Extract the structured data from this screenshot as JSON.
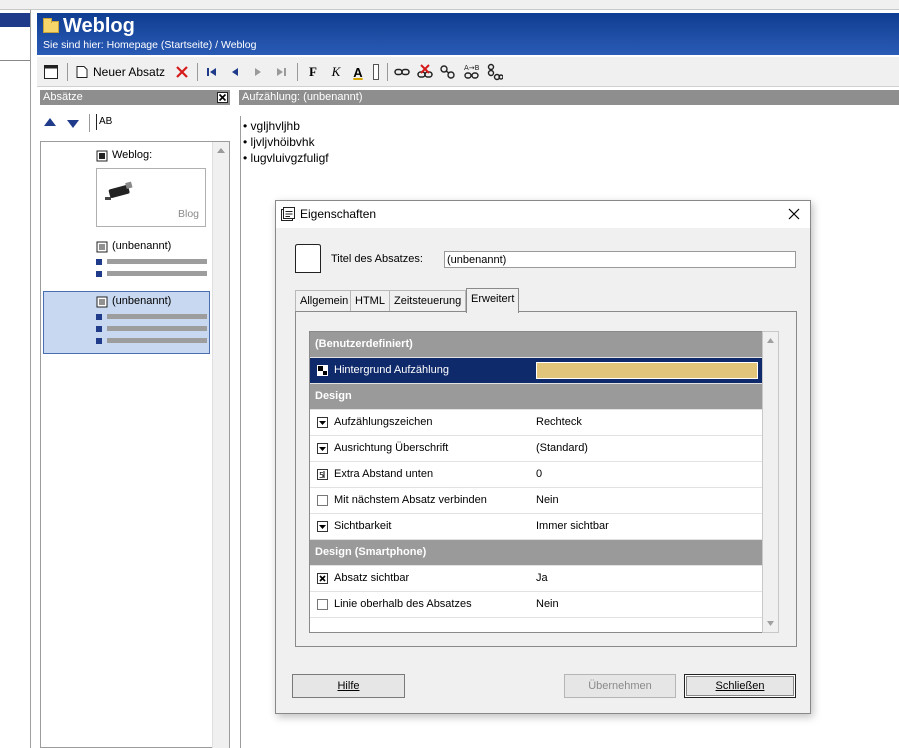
{
  "header": {
    "title": "Weblog",
    "breadcrumb": "Sie sind hier: Homepage (Startseite) / Weblog"
  },
  "toolbar": {
    "new_paragraph_label": "Neuer Absatz",
    "bold_glyph": "F",
    "italic_glyph": "K",
    "underline_glyph": "A"
  },
  "left_pane": {
    "header": "Absätze",
    "sort_label": "AB",
    "items": [
      {
        "label": "Weblog:",
        "thumb_caption": "Blog"
      },
      {
        "label": "(unbenannt)"
      },
      {
        "label": "(unbenannt)"
      }
    ]
  },
  "main_pane": {
    "header": "Aufzählung: (unbenannt)",
    "bullets": [
      "vgljhvljhb",
      "ljvljvhöibvhk",
      "lugvluivgzfuligf"
    ]
  },
  "dialog": {
    "title": "Eigenschaften",
    "field_label": "Titel des Absatzes:",
    "field_value": "(unbenannt)",
    "tabs": [
      "Allgemein",
      "HTML",
      "Zeitsteuerung",
      "Erweitert"
    ],
    "active_tab": "Erweitert",
    "rows": [
      {
        "type": "category",
        "label": "(Benutzerdefiniert)"
      },
      {
        "type": "color",
        "label": "Hintergrund Aufzählung",
        "value_color": "#e0c57a",
        "selected": true
      },
      {
        "type": "category",
        "label": "Design"
      },
      {
        "type": "dropdown",
        "label": "Aufzählungszeichen",
        "value": "Rechteck"
      },
      {
        "type": "dropdown",
        "label": "Ausrichtung Überschrift",
        "value": "(Standard)"
      },
      {
        "type": "number",
        "label": "Extra Abstand unten",
        "value": "0"
      },
      {
        "type": "checkbox",
        "label": "Mit nächstem Absatz verbinden",
        "value": "Nein",
        "checked": false
      },
      {
        "type": "dropdown",
        "label": "Sichtbarkeit",
        "value": "Immer sichtbar"
      },
      {
        "type": "category",
        "label": "Design (Smartphone)"
      },
      {
        "type": "checkbox",
        "label": "Absatz sichtbar",
        "value": "Ja",
        "checked": true
      },
      {
        "type": "checkbox",
        "label": "Linie oberhalb des Absatzes",
        "value": "Nein",
        "checked": false
      }
    ],
    "buttons": {
      "help": "Hilfe",
      "apply": "Übernehmen",
      "close": "Schließen"
    }
  },
  "colors": {
    "header_blue": "#1f4ea3",
    "selection_navy": "#0f2a6b",
    "selected_item": "#c7d8f0",
    "grid_category": "#9a9a9a"
  }
}
